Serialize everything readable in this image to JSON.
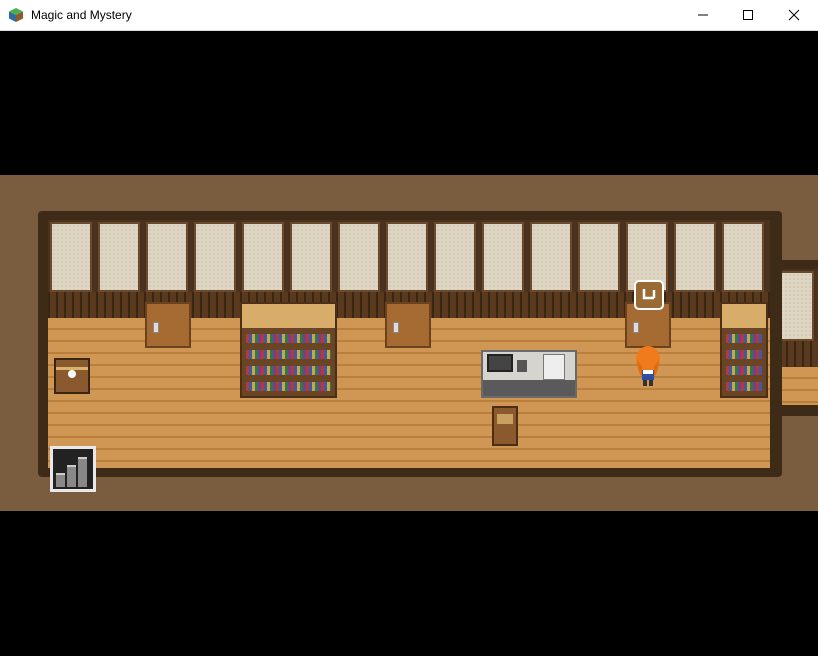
{
  "window": {
    "title": "Magic and Mystery",
    "icon": "game-cube-icon",
    "controls": [
      "minimize-icon",
      "maximize-icon",
      "close-icon"
    ]
  },
  "scene": {
    "type": "top-down-rpg-map",
    "room": "office-hallway",
    "objects": [
      "door",
      "door",
      "door",
      "bookshelf",
      "bookshelf",
      "desk-with-computer",
      "telephone",
      "chair",
      "treasure-chest",
      "staircase",
      "door-sign",
      "player-character"
    ],
    "colors": {
      "wall_panel": "#ded5c3",
      "wood_trim": "#5a3a1f",
      "floor": "#c48a45",
      "outer_ground": "#7a5d3f",
      "letterbox": "#000000"
    }
  }
}
